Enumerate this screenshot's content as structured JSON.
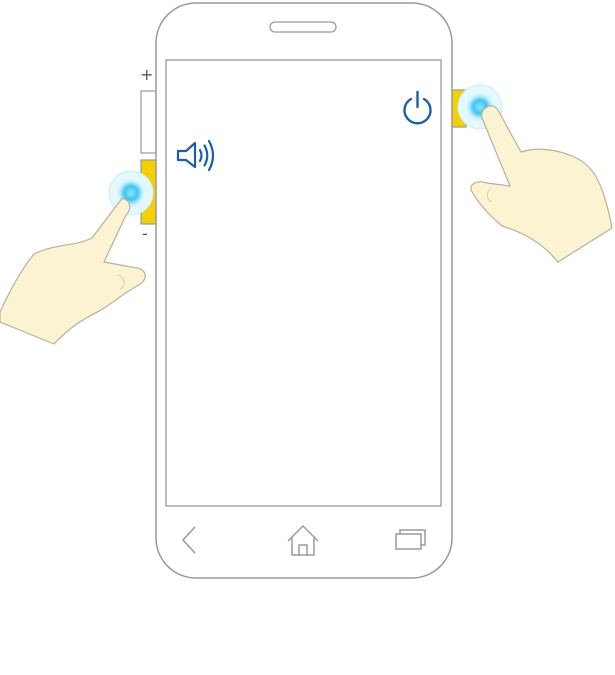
{
  "labels": {
    "volume_up": "+",
    "volume_down": "-"
  },
  "icons": {
    "volume": "speaker-icon",
    "power": "power-icon",
    "back": "back-icon",
    "home": "home-icon",
    "recents": "recent-apps-icon"
  },
  "colors": {
    "highlight_button": "#f5d000",
    "icon_blue": "#1a5fa8",
    "touch_glow": "#3fc6ef",
    "hand_fill": "#fbf3d2",
    "outline": "#9a9a9a"
  }
}
